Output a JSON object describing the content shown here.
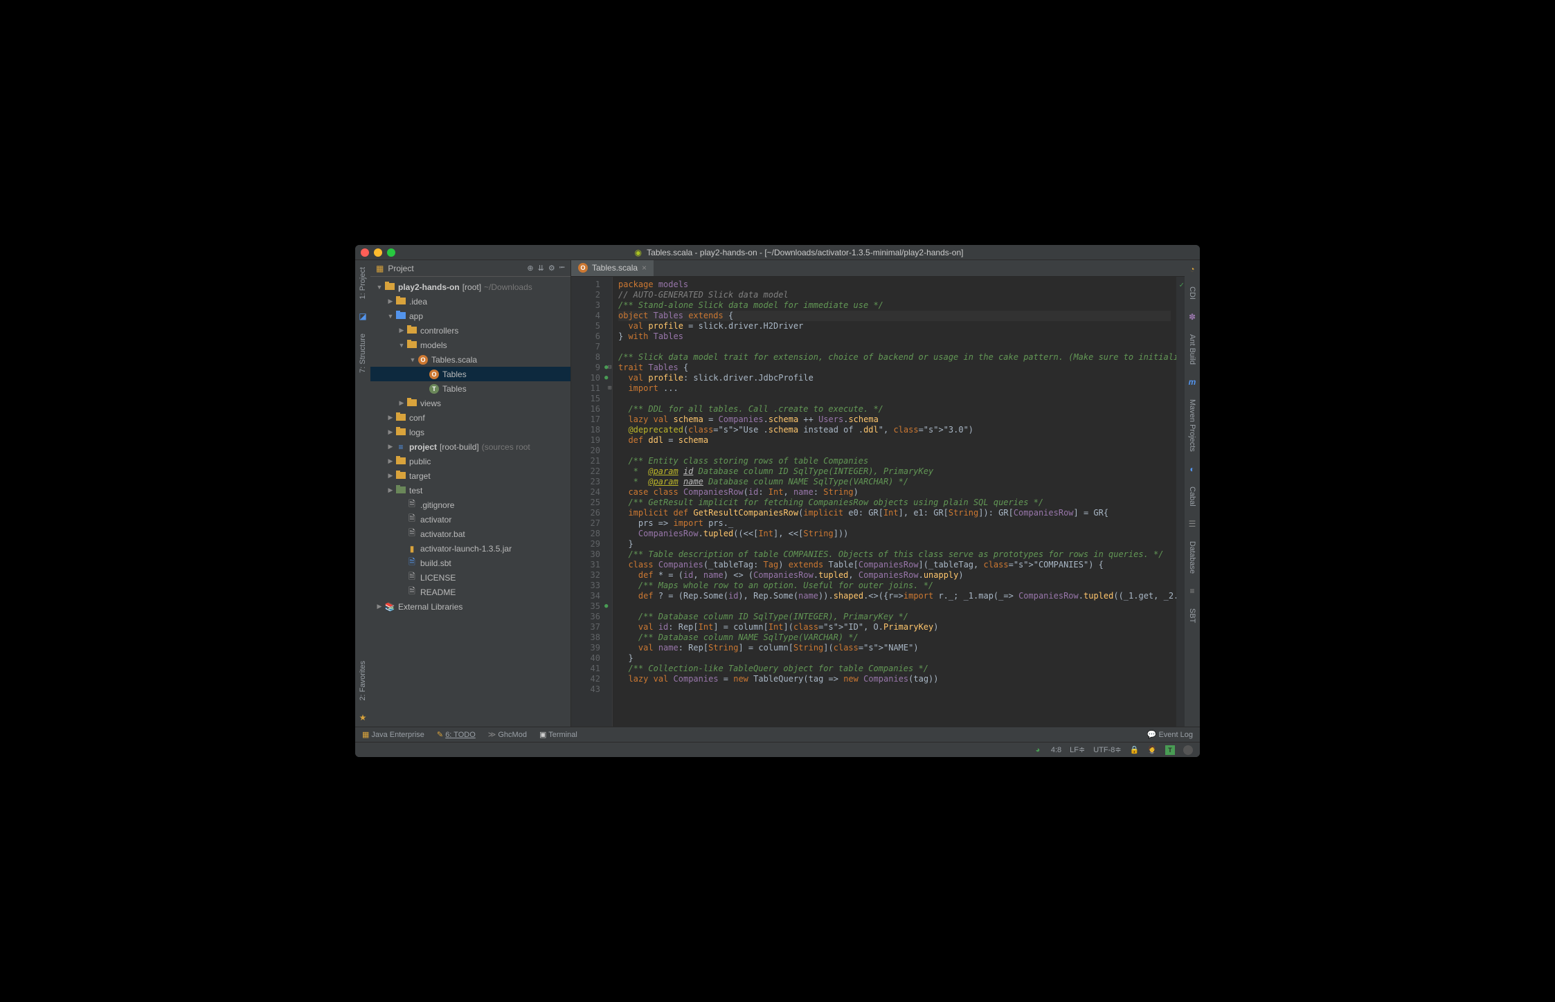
{
  "window": {
    "title_file": "Tables.scala",
    "title_project": "play2-hands-on",
    "title_path": "[~/Downloads/activator-1.3.5-minimal/play2-hands-on]"
  },
  "project_pane": {
    "title": "Project",
    "tree_root_label": "play2-hands-on",
    "tree_root_suffix": "[root]",
    "tree_root_path": "~/Downloads",
    "nodes": {
      "idea": ".idea",
      "app": "app",
      "controllers": "controllers",
      "models": "models",
      "tables_scala": "Tables.scala",
      "tables_o": "Tables",
      "tables_t": "Tables",
      "views": "views",
      "conf": "conf",
      "logs": "logs",
      "project": "project",
      "project_suffix": "[root-build]",
      "project_dim": "(sources root",
      "public": "public",
      "target": "target",
      "test": "test",
      "gitignore": ".gitignore",
      "activator": "activator",
      "activator_bat": "activator.bat",
      "activator_jar": "activator-launch-1.3.5.jar",
      "build_sbt": "build.sbt",
      "license": "LICENSE",
      "readme": "README",
      "ext_lib": "External Libraries"
    }
  },
  "left_rail": {
    "project": "1: Project",
    "structure": "7: Structure",
    "favorites": "2: Favorites"
  },
  "right_rail": {
    "cdi": "CDI",
    "ant": "Ant Build",
    "maven": "Maven Projects",
    "cabal": "Cabal",
    "database": "Database",
    "sbt": "SBT"
  },
  "tabs": [
    {
      "label": "Tables.scala"
    }
  ],
  "code_lines": [
    "package models",
    "// AUTO-GENERATED Slick data model",
    "/** Stand-alone Slick data model for immediate use */",
    "object Tables extends {",
    "  val profile = slick.driver.H2Driver",
    "} with Tables",
    "",
    "/** Slick data model trait for extension, choice of backend or usage in the cake pattern. (Make sure to initiali",
    "trait Tables {",
    "  val profile: slick.driver.JdbcProfile",
    "  import ...",
    "",
    "  /** DDL for all tables. Call .create to execute. */",
    "  lazy val schema = Companies.schema ++ Users.schema",
    "  @deprecated(\"Use .schema instead of .ddl\", \"3.0\")",
    "  def ddl = schema",
    "",
    "  /** Entity class storing rows of table Companies",
    "   *  @param id Database column ID SqlType(INTEGER), PrimaryKey",
    "   *  @param name Database column NAME SqlType(VARCHAR) */",
    "  case class CompaniesRow(id: Int, name: String)",
    "  /** GetResult implicit for fetching CompaniesRow objects using plain SQL queries */",
    "  implicit def GetResultCompaniesRow(implicit e0: GR[Int], e1: GR[String]): GR[CompaniesRow] = GR{",
    "    prs => import prs._",
    "    CompaniesRow.tupled((<<[Int], <<[String]))",
    "  }",
    "  /** Table description of table COMPANIES. Objects of this class serve as prototypes for rows in queries. */",
    "  class Companies(_tableTag: Tag) extends Table[CompaniesRow](_tableTag, \"COMPANIES\") {",
    "    def * = (id, name) <> (CompaniesRow.tupled, CompaniesRow.unapply)",
    "    /** Maps whole row to an option. Useful for outer joins. */",
    "    def ? = (Rep.Some(id), Rep.Some(name)).shaped.<>({r=>import r._; _1.map(_=> CompaniesRow.tupled((_1.get, _2.",
    "",
    "    /** Database column ID SqlType(INTEGER), PrimaryKey */",
    "    val id: Rep[Int] = column[Int](\"ID\", O.PrimaryKey)",
    "    /** Database column NAME SqlType(VARCHAR) */",
    "    val name: Rep[String] = column[String](\"NAME\")",
    "  }",
    "  /** Collection-like TableQuery object for table Companies */",
    "  lazy val Companies = new TableQuery(tag => new Companies(tag))",
    ""
  ],
  "line_numbers_start": 1,
  "line_numbers_skip_after": 11,
  "line_numbers_skip_to": 15,
  "bottom": {
    "java_ee": "Java Enterprise",
    "todo": "6: TODO",
    "ghc": "GhcMod",
    "terminal": "Terminal",
    "event_log": "Event Log"
  },
  "status": {
    "clock": "",
    "pos": "4:8",
    "lf": "LF≑",
    "enc": "UTF-8≑",
    "lock": "🔒",
    "man": "",
    "insp": "[T]"
  }
}
